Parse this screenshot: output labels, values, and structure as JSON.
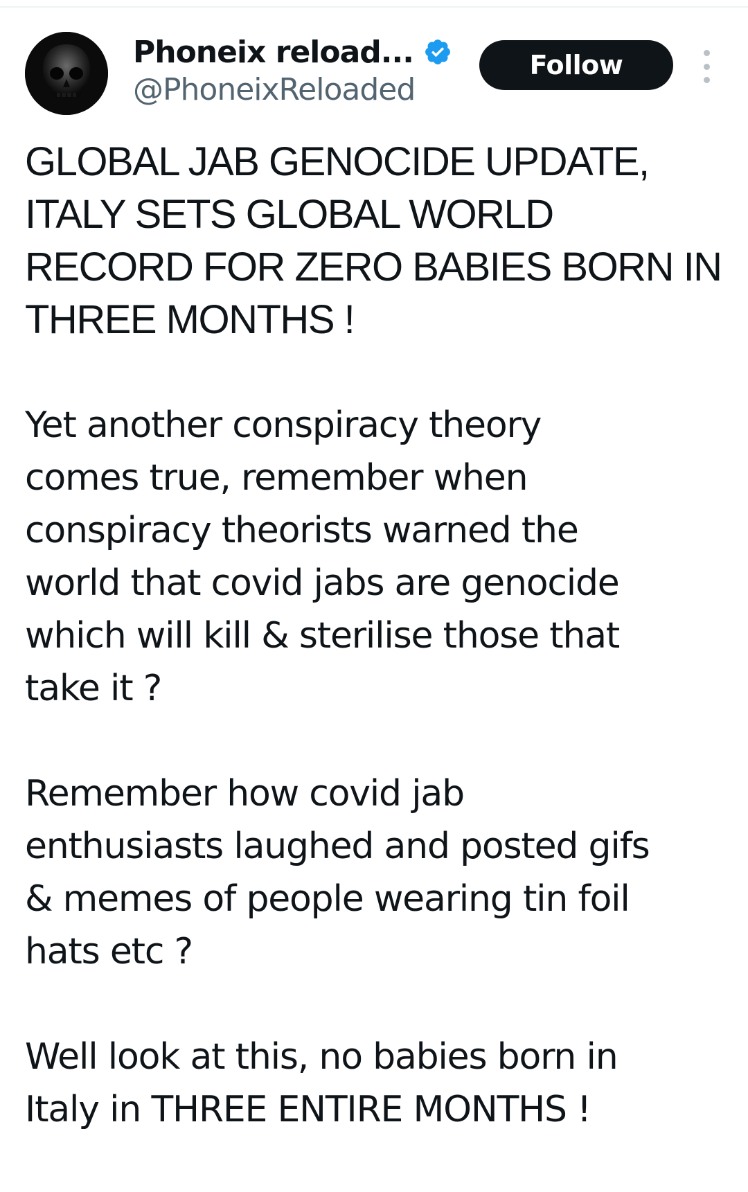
{
  "author": {
    "display_name": "Phoneix reload...",
    "handle": "@PhoneixReloaded",
    "avatar_icon": "skull-avatar",
    "verified_icon": "verified-badge-icon",
    "verified_color": "#1d9bf0"
  },
  "actions": {
    "follow_label": "Follow",
    "more_icon": "more-vertical-icon"
  },
  "tweet": {
    "paragraphs": [
      "GLOBAL JAB GENOCIDE UPDATE,\nITALY SETS GLOBAL WORLD\nRECORD FOR ZERO BABIES BORN IN\nTHREE MONTHS !",
      "Yet another conspiracy theory\ncomes true, remember when\nconspiracy theorists warned the\nworld that covid jabs are genocide\nwhich will kill & sterilise those that\ntake it ?",
      "Remember how covid jab\nenthusiasts laughed and posted gifs\n& memes of people wearing tin foil\nhats etc ?",
      "Well look at this, no babies born in\nItaly in THREE ENTIRE MONTHS !"
    ]
  },
  "colors": {
    "text_primary": "#0f1419",
    "text_secondary": "#536471",
    "button_bg": "#0f1419",
    "button_text": "#ffffff"
  }
}
